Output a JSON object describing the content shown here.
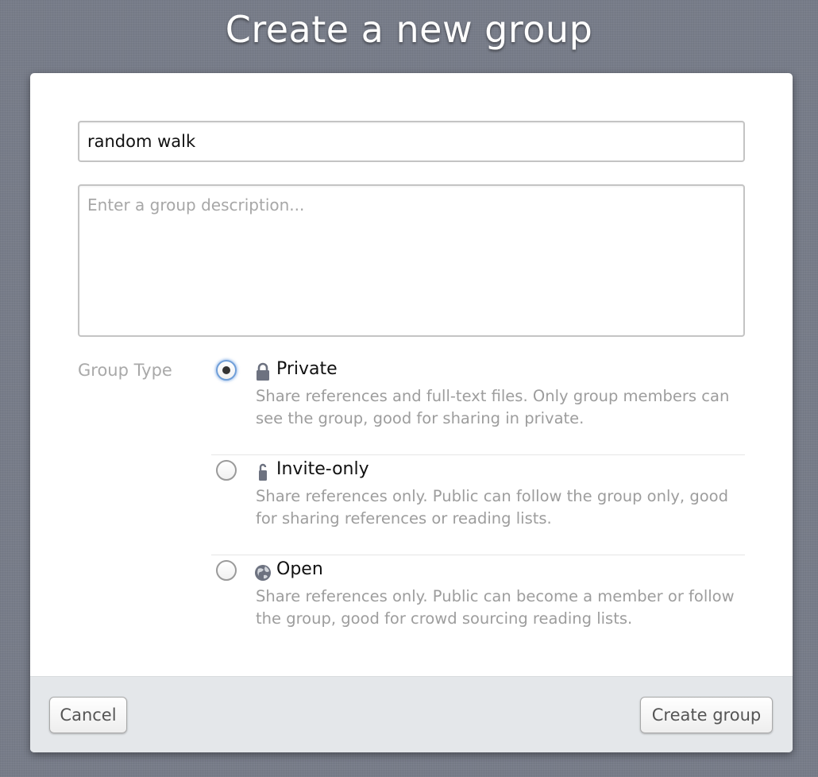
{
  "page": {
    "title": "Create a new group"
  },
  "form": {
    "name_value": "random walk",
    "description_placeholder": "Enter a group description...",
    "description_value": ""
  },
  "group_type": {
    "label": "Group Type",
    "selected": "private",
    "options": [
      {
        "id": "private",
        "label": "Private",
        "icon": "lock-icon",
        "checked": true,
        "description": "Share references and full-text files. Only group members can see the group, good for sharing in private."
      },
      {
        "id": "invite-only",
        "label": "Invite-only",
        "icon": "half-lock-icon",
        "checked": false,
        "description": "Share references only. Public can follow the group only, good for sharing references or reading lists."
      },
      {
        "id": "open",
        "label": "Open",
        "icon": "globe-icon",
        "checked": false,
        "description": "Share references only. Public can become a member or follow the group, good for crowd sourcing reading lists."
      }
    ]
  },
  "footer": {
    "cancel_label": "Cancel",
    "create_label": "Create group"
  },
  "colors": {
    "background": "#777c89",
    "dialog": "#ffffff",
    "footer": "#e4e7ea",
    "radio_focus": "#6f9ed8",
    "muted_text": "#9d9d9d"
  }
}
